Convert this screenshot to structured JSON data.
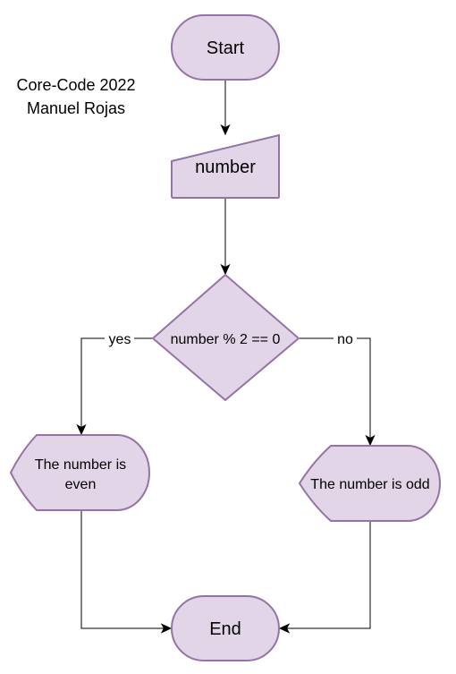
{
  "author_note": {
    "line1": "Core-Code 2022",
    "line2": "Manuel Rojas"
  },
  "nodes": {
    "start": "Start",
    "input": "number",
    "decision": "number % 2 == 0",
    "even_line1": "The number is",
    "even_line2": "even",
    "odd": "The number is odd",
    "end": "End"
  },
  "edges": {
    "yes_label": "yes",
    "no_label": "no"
  },
  "colors": {
    "node_fill": "#e1d5e7",
    "node_stroke": "#9673a6",
    "edge": "#000000"
  }
}
